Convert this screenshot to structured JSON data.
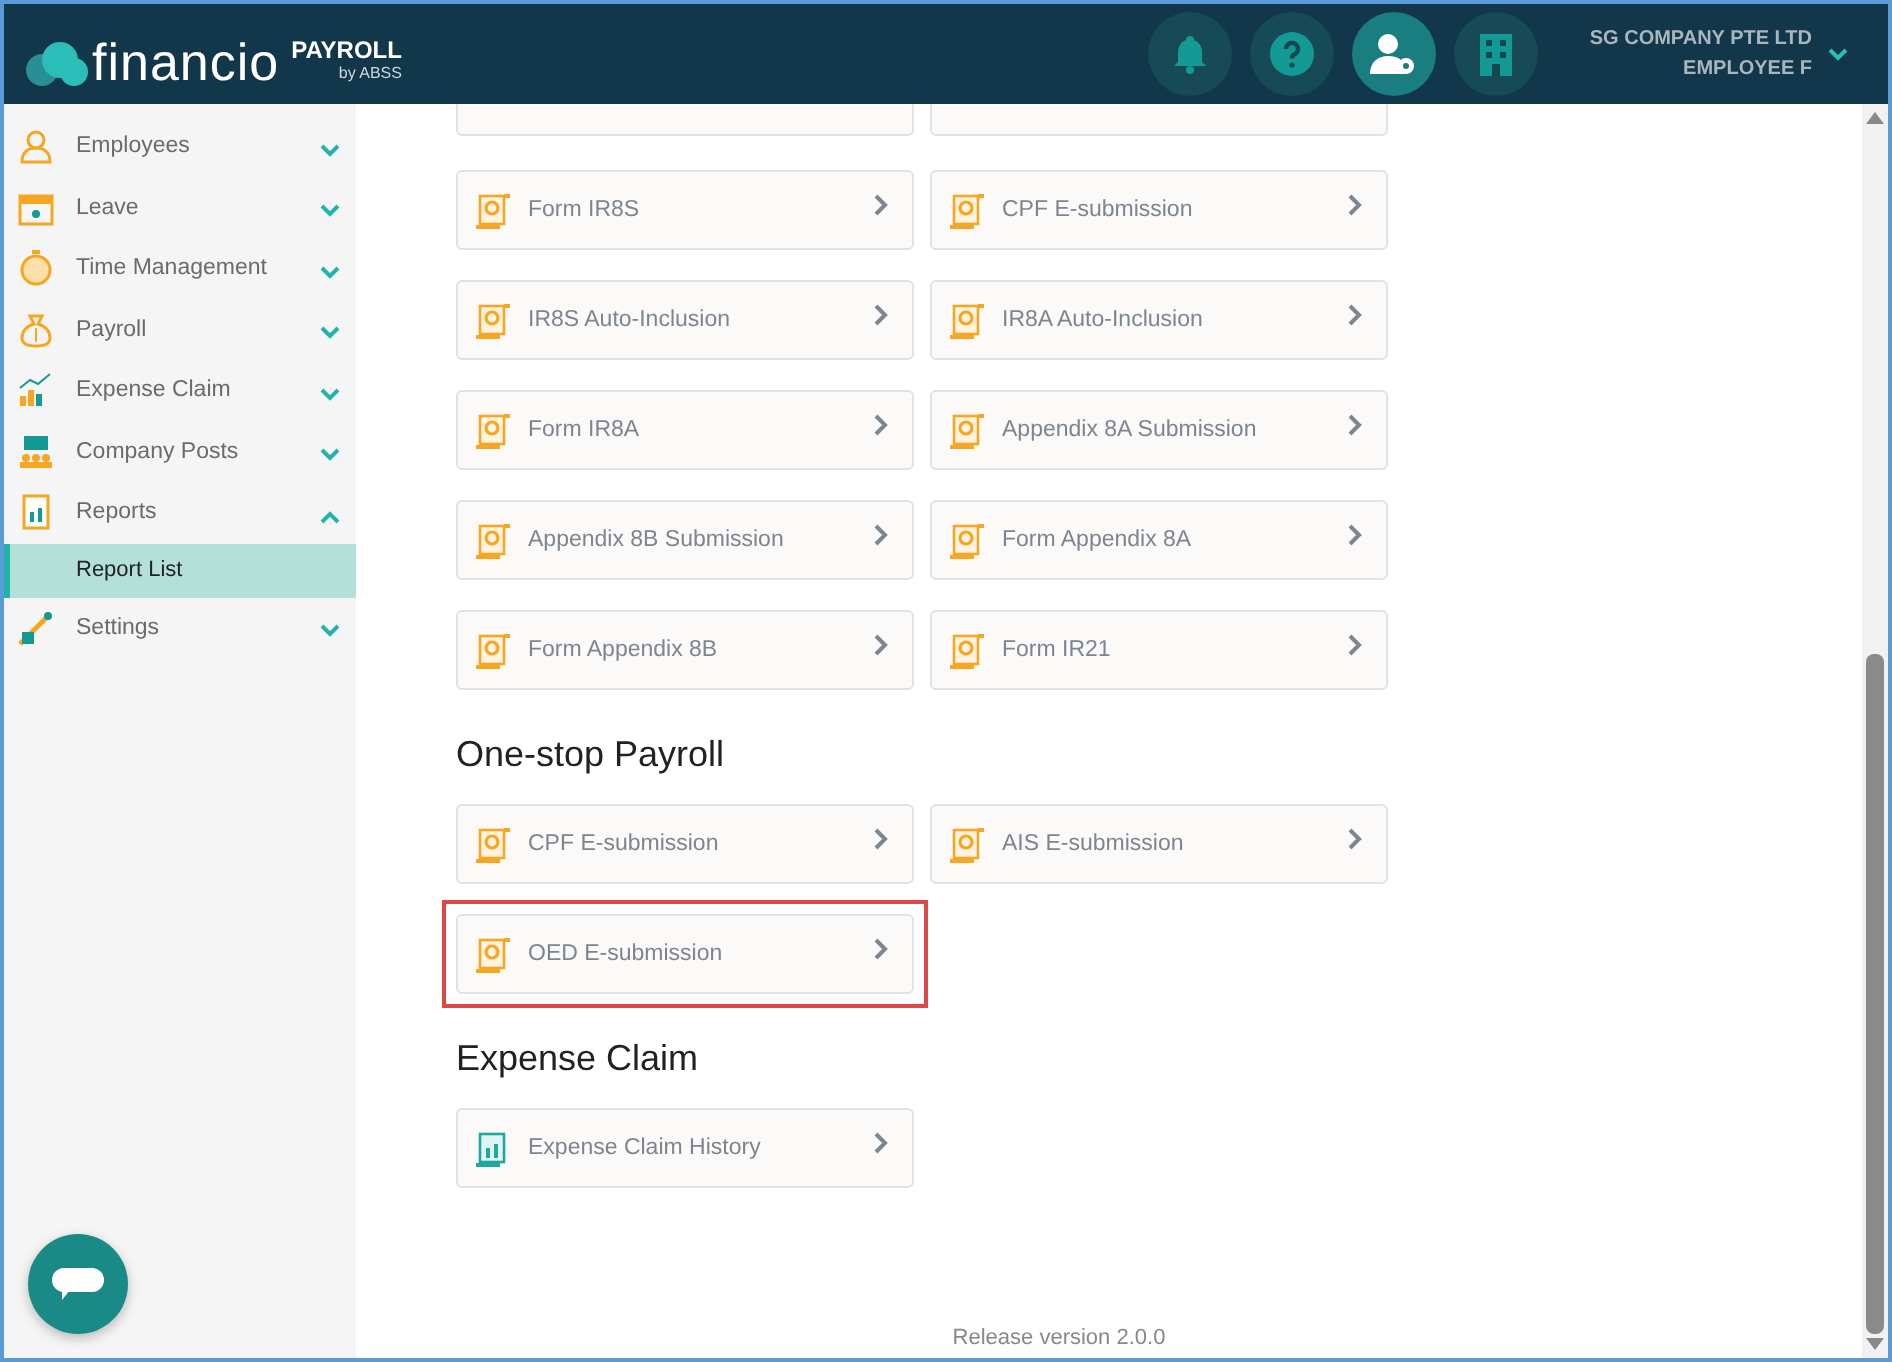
{
  "header": {
    "logo": "financio",
    "product": "PAYROLL",
    "byline": "by ABSS",
    "icons": [
      {
        "kind": "bell",
        "selected": false
      },
      {
        "kind": "help",
        "selected": false
      },
      {
        "kind": "user-settings",
        "selected": true
      },
      {
        "kind": "building",
        "selected": false
      }
    ],
    "company": "SG COMPANY PTE LTD",
    "user": "EMPLOYEE F"
  },
  "sidebar": {
    "items": [
      {
        "label": "Employees",
        "kind": "person",
        "expanded": false
      },
      {
        "label": "Leave",
        "kind": "calendar",
        "expanded": false
      },
      {
        "label": "Time Management",
        "kind": "stopwatch",
        "expanded": false
      },
      {
        "label": "Payroll",
        "kind": "moneybag",
        "expanded": false
      },
      {
        "label": "Expense Claim",
        "kind": "growth",
        "expanded": false
      },
      {
        "label": "Company Posts",
        "kind": "people",
        "expanded": false
      },
      {
        "label": "Reports",
        "kind": "report",
        "expanded": true,
        "children": [
          {
            "label": "Report List",
            "selected": true
          }
        ]
      },
      {
        "label": "Settings",
        "kind": "tools",
        "expanded": false
      }
    ]
  },
  "sections": [
    {
      "cards": [
        {
          "label": "Form IR8S",
          "kind": "form",
          "highlighted": false
        },
        {
          "label": "CPF E-submission",
          "kind": "form",
          "highlighted": false
        },
        {
          "label": "IR8S Auto-Inclusion",
          "kind": "form",
          "highlighted": false
        },
        {
          "label": "IR8A Auto-Inclusion",
          "kind": "form",
          "highlighted": false
        },
        {
          "label": "Form IR8A",
          "kind": "form",
          "highlighted": false
        },
        {
          "label": "Appendix 8A Submission",
          "kind": "form",
          "highlighted": false
        },
        {
          "label": "Appendix 8B Submission",
          "kind": "form",
          "highlighted": false
        },
        {
          "label": "Form Appendix 8A",
          "kind": "form",
          "highlighted": false
        },
        {
          "label": "Form Appendix 8B",
          "kind": "form",
          "highlighted": false
        },
        {
          "label": "Form IR21",
          "kind": "form",
          "highlighted": false
        }
      ]
    },
    {
      "title": "One-stop Payroll",
      "cards": [
        {
          "label": "CPF E-submission",
          "kind": "form",
          "highlighted": false
        },
        {
          "label": "AIS E-submission",
          "kind": "form",
          "highlighted": false
        },
        {
          "label": "OED E-submission",
          "kind": "form",
          "highlighted": true
        }
      ]
    },
    {
      "title": "Expense Claim",
      "cards": [
        {
          "label": "Expense Claim History",
          "kind": "chart",
          "highlighted": false
        }
      ]
    }
  ],
  "footer": {
    "release": "Release version 2.0.0"
  }
}
